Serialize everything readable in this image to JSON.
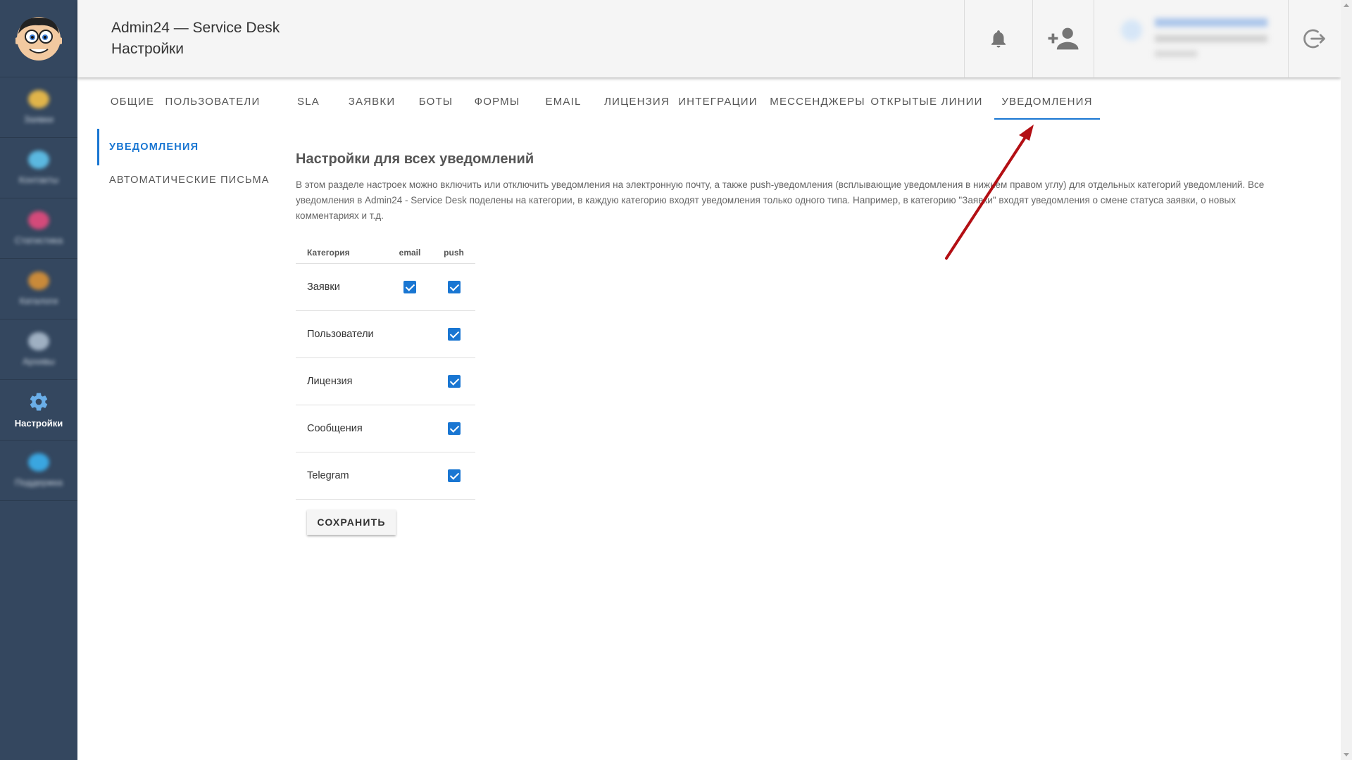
{
  "header": {
    "app_title": "Admin24 — Service Desk",
    "page_title": "Настройки"
  },
  "rail": {
    "items": [
      {
        "label": "Заявки",
        "icon": "requests-icon",
        "blurred": true,
        "color": "#e0b44a"
      },
      {
        "label": "Контакты",
        "icon": "contacts-icon",
        "blurred": true,
        "color": "#5bb8e0"
      },
      {
        "label": "Статистика",
        "icon": "stats-icon",
        "blurred": true,
        "color": "#d44a7a"
      },
      {
        "label": "Каталоги",
        "icon": "catalog-icon",
        "blurred": true,
        "color": "#c98a3a"
      },
      {
        "label": "Архивы",
        "icon": "archive-icon",
        "blurred": true,
        "color": "#9fb0c2"
      },
      {
        "label": "Настройки",
        "icon": "gear-icon",
        "blurred": false,
        "color": "#6aaee8"
      },
      {
        "label": "Поддержка",
        "icon": "support-icon",
        "blurred": true,
        "color": "#3aa6e0"
      }
    ]
  },
  "tabs": [
    {
      "label": "ОБЩИЕ"
    },
    {
      "label": "ПОЛЬЗОВАТЕЛИ"
    },
    {
      "label": "SLA"
    },
    {
      "label": "ЗАЯВКИ"
    },
    {
      "label": "БОТЫ"
    },
    {
      "label": "ФОРМЫ"
    },
    {
      "label": "EMAIL"
    },
    {
      "label": "ЛИЦЕНЗИЯ"
    },
    {
      "label": "ИНТЕГРАЦИИ"
    },
    {
      "label": "МЕССЕНДЖЕРЫ"
    },
    {
      "label": "ОТКРЫТЫЕ ЛИНИИ"
    },
    {
      "label": "УВЕДОМЛЕНИЯ",
      "active": true
    }
  ],
  "subnav": {
    "active": "УВЕДОМЛЕНИЯ",
    "inactive": "АВТОМАТИЧЕСКИЕ ПИСЬМА"
  },
  "main": {
    "heading": "Настройки для всех уведомлений",
    "description": "В этом разделе настроек можно включить или отключить уведомления на электронную почту, а также push-уведомления (всплывающие уведомления в нижнем правом углу) для отдельных категорий уведомлений. Все уведомления в Admin24 - Service Desk поделены на категории, в каждую категорию входят уведомления только одного типа. Например, в категорию \"Заявки\" входят уведомления о смене статуса заявки, о новых комментариях и т.д."
  },
  "table": {
    "headers": [
      "Категория",
      "email",
      "push"
    ],
    "rows": [
      {
        "category": "Заявки",
        "email": true,
        "push": true
      },
      {
        "category": "Пользователи",
        "email": null,
        "push": true
      },
      {
        "category": "Лицензия",
        "email": null,
        "push": true
      },
      {
        "category": "Сообщения",
        "email": null,
        "push": true
      },
      {
        "category": "Telegram",
        "email": null,
        "push": true
      }
    ]
  },
  "actions": {
    "save_label": "СОХРАНИТЬ"
  },
  "colors": {
    "accent": "#1976d2",
    "rail": "#34475f",
    "annotation_arrow": "#b30f14"
  }
}
